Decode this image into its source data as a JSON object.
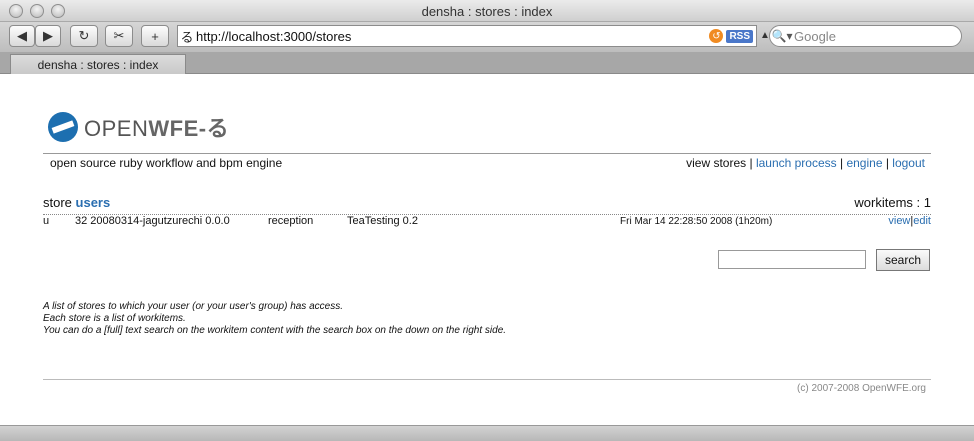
{
  "window": {
    "title": "densha : stores : index"
  },
  "toolbar": {
    "url": "http://localhost:3000/stores",
    "search_placeholder": "Google",
    "rss_label": "RSS"
  },
  "tabs": [
    {
      "label": "densha : stores : index"
    }
  ],
  "header": {
    "logo_open": "OPEN",
    "logo_wfe": "WFE-る",
    "tagline": "open source ruby workflow and bpm engine"
  },
  "nav": {
    "view_stores": "view stores",
    "launch_process": "launch process",
    "engine": "engine",
    "logout": "logout"
  },
  "store": {
    "prefix": "store",
    "name": "users",
    "workitems_label": "workitems : 1"
  },
  "workitems": [
    {
      "col1": "u",
      "col2": "32 20080314-jagutzurechi 0.0.0",
      "col3": "reception",
      "process": "TeaTesting 0.2",
      "date": "Fri Mar 14 22:28:50 2008 (1h20m)",
      "view": "view",
      "sep": "|",
      "edit": "edit"
    }
  ],
  "search": {
    "button": "search"
  },
  "help": {
    "line1": "A list of stores to which your user (or your user's group) has access.",
    "line2": "Each store is a list of workitems.",
    "line3": "You can do a [full] text search on the workitem content with the search box on the down on the right side."
  },
  "footer": {
    "copyright": "(c) 2007-2008 OpenWFE.org"
  }
}
